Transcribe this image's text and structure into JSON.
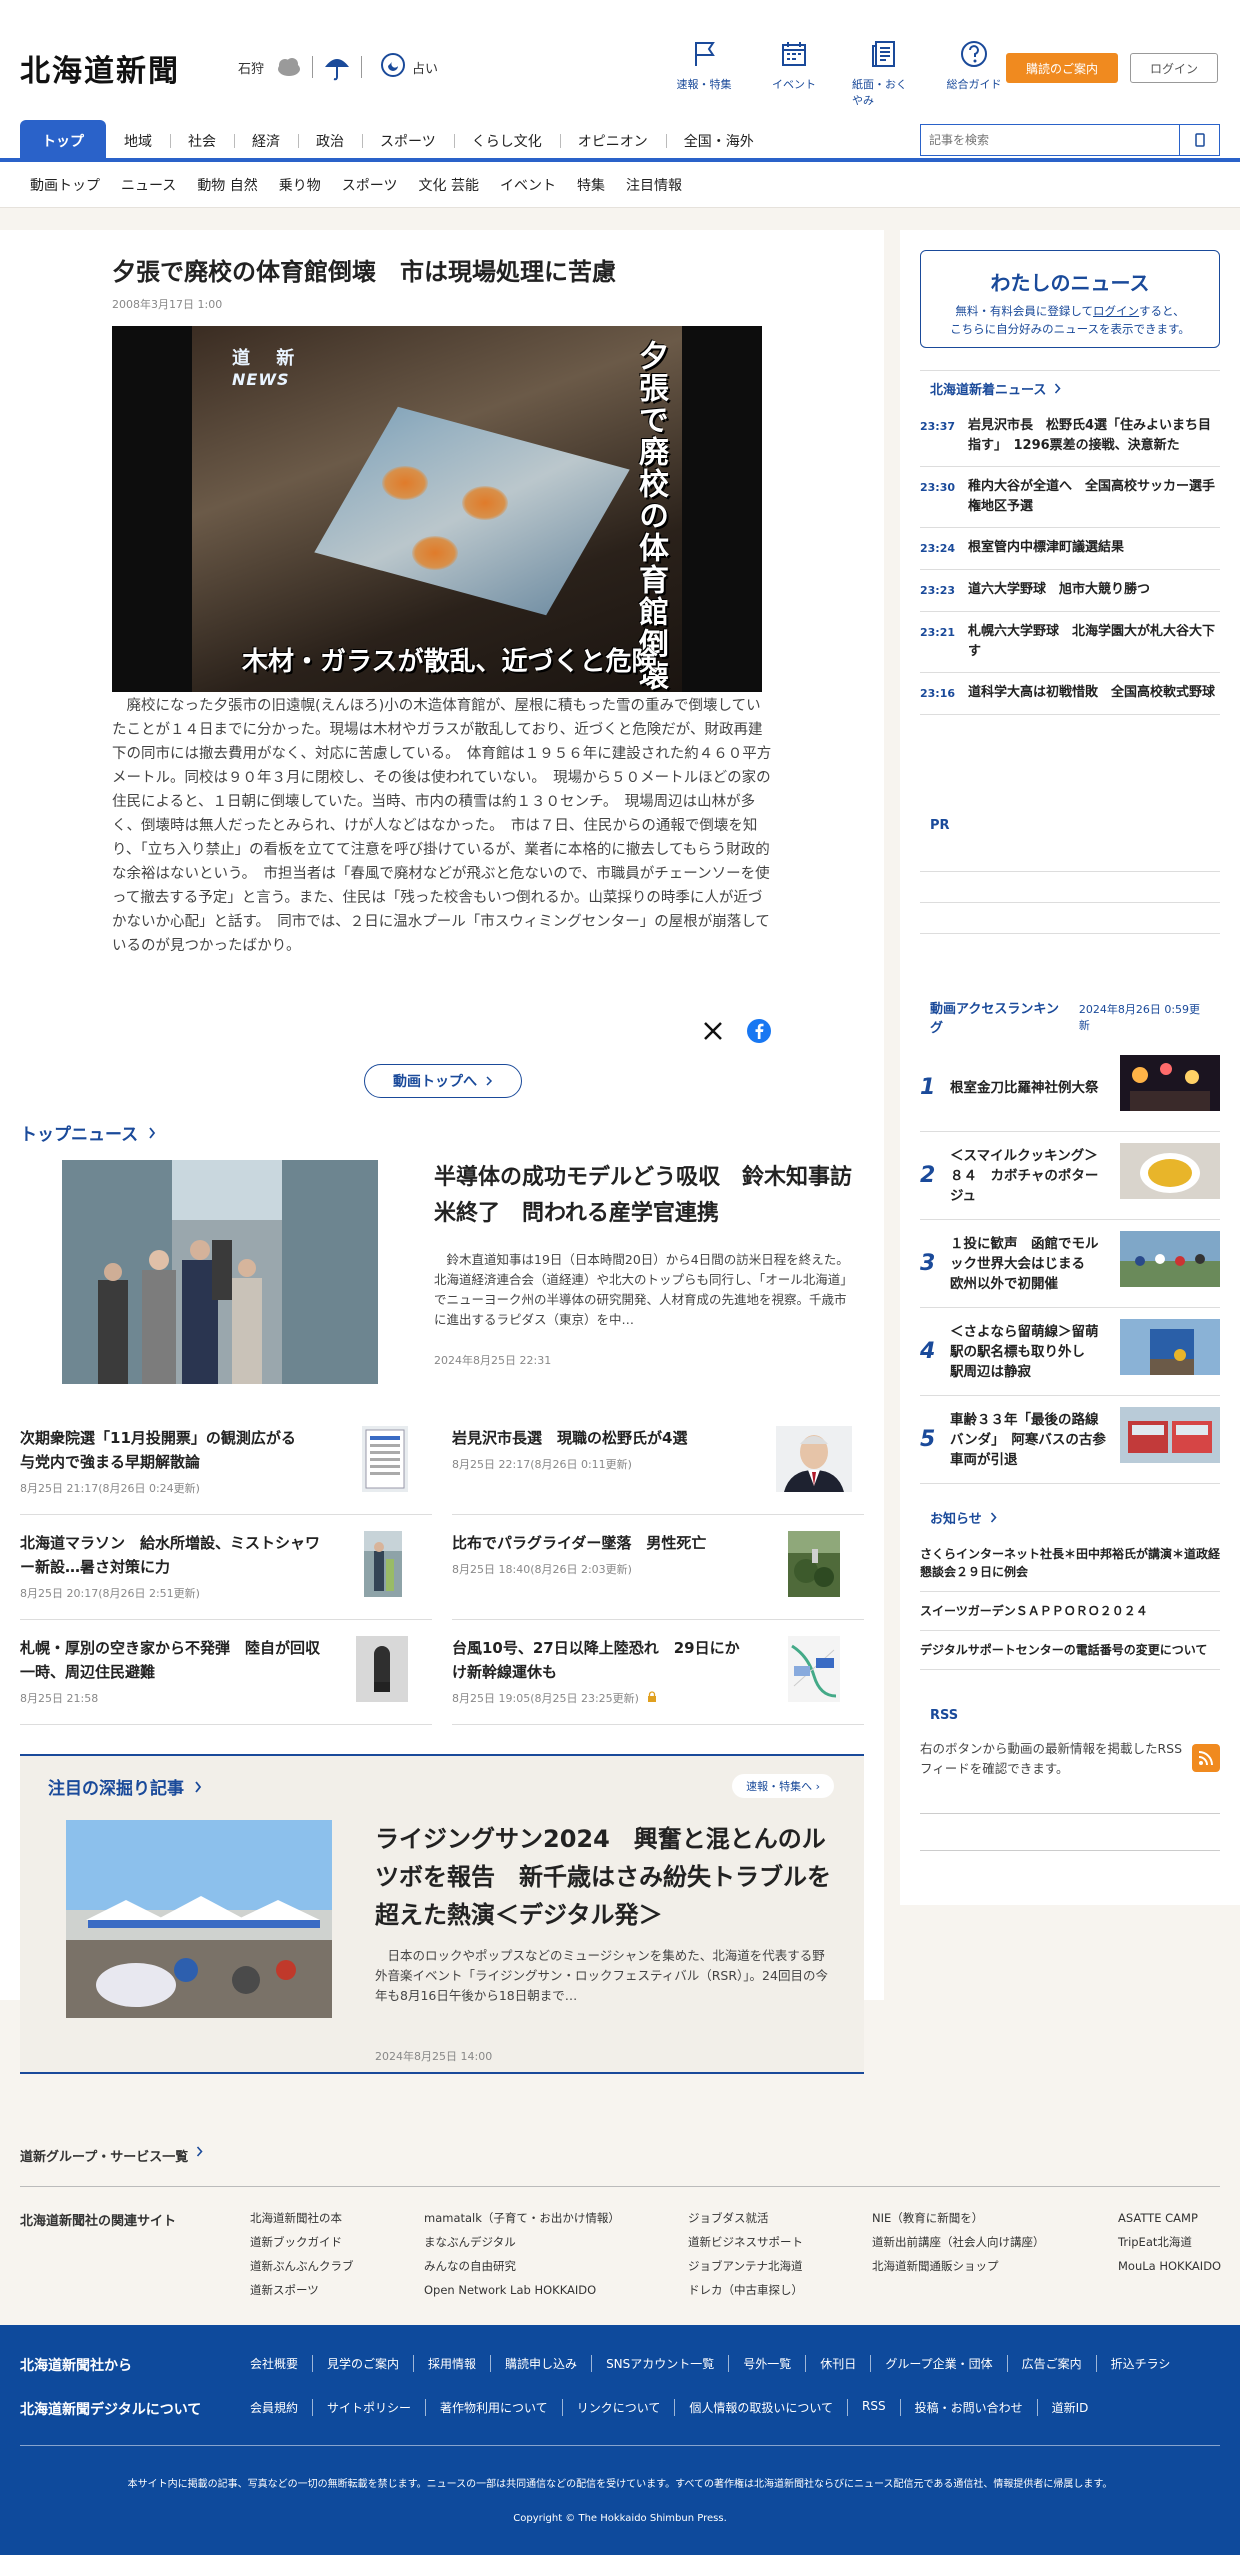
{
  "header": {
    "logo": "北海道新聞",
    "weather_area": "石狩",
    "fortune": "占い",
    "nav": [
      {
        "label": "速報・特集"
      },
      {
        "label": "イベント"
      },
      {
        "label": "紙面・おくやみ"
      },
      {
        "label": "総合ガイド"
      }
    ],
    "subscribe": "購読のご案内",
    "login": "ログイン"
  },
  "mainnav": {
    "tabs": [
      "トップ",
      "地域",
      "社会",
      "経済",
      "政治",
      "スポーツ",
      "くらし文化",
      "オピニオン",
      "全国・海外"
    ],
    "search_placeholder": "記事を検索"
  },
  "subnav": [
    "動画トップ",
    "ニュース",
    "動物 自然",
    "乗り物",
    "スポーツ",
    "文化 芸能",
    "イベント",
    "特集",
    "注目情報"
  ],
  "article": {
    "title": "夕張で廃校の体育館倒壊　市は現場処理に苦慮",
    "date": "2008年3月17日 1:00",
    "photo_vertical_title": "夕張で廃校の体育館倒壊",
    "photo_caption": "木材・ガラスが散乱、近づくと危険",
    "photo_logo_jp": "道 新",
    "photo_logo_en": "NEWS",
    "body": "廃校になった夕張市の旧遠幌(えんほろ)小の木造体育館が、屋根に積もった雪の重みで倒壊していたことが１４日までに分かった。現場は木材やガラスが散乱しており、近づくと危険だが、財政再建下の同市には撤去費用がなく、対応に苦慮している。　体育館は１９５６年に建設された約４６０平方メートル。同校は９０年３月に閉校し、その後は使われていない。　現場から５０メートルほどの家の住民によると、１日朝に倒壊していた。当時、市内の積雪は約１３０センチ。　現場周辺は山林が多く、倒壊時は無人だったとみられ、けが人などはなかった。　市は７日、住民からの通報で倒壊を知り、「立ち入り禁止」の看板を立てて注意を呼び掛けているが、業者に本格的に撤去してもらう財政的な余裕はないという。　市担当者は「春風で廃材などが飛ぶと危ないので、市職員がチェーンソーを使って撤去する予定」と言う。また、住民は「残った校舎もいつ倒れるか。山菜採りの時季に人が近づかないか心配」と話す。　同市では、２日に温水プール「市スウィミングセンター」の屋根が崩落しているのが見つかったばかり。",
    "video_top": "動画トップへ"
  },
  "top_news": {
    "heading": "トップニュース",
    "main": {
      "title": "半導体の成功モデルどう吸収　鈴木知事訪米終了　問われる産学官連携",
      "summary": "鈴木直道知事は19日（日本時間20日）から4日間の訪米日程を終えた。北海道経済連合会（道経連）や北大のトップらも同行し、「オール北海道」でニューヨーク州の半導体の研究開発、人材育成の先進地を視察。千歳市に進出するラピダス（東京）を中…",
      "date": "2024年8月25日 22:31"
    },
    "items": [
      {
        "title": "次期衆院選「11月投開票」の観測広がる　与党内で強まる早期解散論",
        "date": "8月25日 21:17(8月26日 0:24更新)"
      },
      {
        "title": "岩見沢市長選　現職の松野氏が4選",
        "date": "8月25日 22:17(8月26日 0:11更新)"
      },
      {
        "title": "北海道マラソン　給水所増設、ミストシャワー新設…暑さ対策に力",
        "date": "8月25日 20:17(8月26日 2:51更新)"
      },
      {
        "title": "比布でパラグライダー墜落　男性死亡",
        "date": "8月25日 18:40(8月26日 2:03更新)"
      },
      {
        "title": "札幌・厚別の空き家から不発弾　陸自が回収　一時、周辺住民避難",
        "date": "8月25日 21:58"
      },
      {
        "title": "台風10号、27日以降上陸恐れ　29日にかけ新幹線運休も",
        "date": "8月25日 19:05(8月25日 23:25更新)"
      }
    ]
  },
  "deep_dive": {
    "heading": "注目の深掘り記事",
    "link": "速報・特集へ",
    "title": "ライジングサン2024　興奮と混とんのルツボを報告　新千歳はさみ紛失トラブルを超えた熱演＜デジタル発＞",
    "summary": "日本のロックやポップスなどのミュージシャンを集めた、北海道を代表する野外音楽イベント「ライジングサン・ロックフェスティバル（RSR）」。24回目の今年も8月16日午後から18日朝まで…",
    "date": "2024年8月25日 14:00"
  },
  "sidebar": {
    "mynews_title": "わたしのニュース",
    "mynews_text_1": "無料・有料会員に登録して",
    "mynews_login": "ログイン",
    "mynews_text_2": "すると、",
    "mynews_text_3": "こちらに自分好みのニュースを表示できます。",
    "latest_heading": "北海道新着ニュース",
    "latest": [
      {
        "time": "23:37",
        "title": "岩見沢市長　松野氏4選「住みよいまち目指す」　1296票差の接戦、決意新た"
      },
      {
        "time": "23:30",
        "title": "稚内大谷が全道へ　全国高校サッカー選手権地区予選"
      },
      {
        "time": "23:24",
        "title": "根室管内中標津町議選結果"
      },
      {
        "time": "23:23",
        "title": "道六大学野球　旭市大競り勝つ"
      },
      {
        "time": "23:21",
        "title": "札幌六大学野球　北海学園大が札大谷大下す"
      },
      {
        "time": "23:16",
        "title": "道科学大高は初戦惜敗　全国高校軟式野球"
      }
    ],
    "pr_heading": "PR",
    "ranking_heading": "動画アクセスランキング",
    "ranking_date": "2024年8月26日 0:59更新",
    "ranking": [
      {
        "rank": "1",
        "title": "根室金刀比羅神社例大祭"
      },
      {
        "rank": "2",
        "title": "＜スマイルクッキング＞８４　カボチャのポタージュ"
      },
      {
        "rank": "3",
        "title": "１投に歓声　函館でモルック世界大会はじまる　欧州以外で初開催"
      },
      {
        "rank": "4",
        "title": "＜さよなら留萌線＞留萌駅の駅名標も取り外し　駅周辺は静寂"
      },
      {
        "rank": "5",
        "title": "車齢３３年「最後の路線バンダ」　阿寒バスの古参車両が引退"
      }
    ],
    "notice_heading": "お知らせ",
    "notices": [
      "さくらインターネット社長＊田中邦裕氏が講演＊道政経懇談会２９日に例会",
      "スイーツガーデンＳＡＰＰＯＲＯ２０２４",
      "デジタルサポートセンターの電話番号の変更について"
    ],
    "rss_heading": "RSS",
    "rss_text": "右のボタンから動画の最新情報を掲載したRSSフィードを確認できます。"
  },
  "group": {
    "heading": "道新グループ・サービス一覧",
    "label": "北海道新聞社の関連サイト",
    "col1": [
      "北海道新聞社の本",
      "道新ブックガイド",
      "道新ぶんぶんクラブ",
      "道新スポーツ"
    ],
    "col2": [
      "mamatalk（子育て・お出かけ情報）",
      "まなぶんデジタル",
      "みんなの自由研究",
      "Open Network Lab HOKKAIDO"
    ],
    "col3": [
      "ジョブダス就活",
      "道新ビジネスサポート",
      "ジョブアンテナ北海道",
      "ドレカ（中古車探し）"
    ],
    "col4": [
      "NIE（教育に新聞を）",
      "道新出前講座（社会人向け講座）",
      "北海道新聞通販ショップ"
    ],
    "col5": [
      "ASATTE CAMP",
      "TripEat北海道",
      "MouLa HOKKAIDO"
    ]
  },
  "footer": {
    "label1": "北海道新聞社から",
    "links1": [
      "会社概要",
      "見学のご案内",
      "採用情報",
      "購読申し込み",
      "SNSアカウント一覧",
      "号外一覧",
      "休刊日",
      "グループ企業・団体",
      "広告ご案内",
      "折込チラシ"
    ],
    "label2": "北海道新聞デジタルについて",
    "links2": [
      "会員規約",
      "サイトポリシー",
      "著作物利用について",
      "リンクについて",
      "個人情報の取扱いについて",
      "RSS",
      "投稿・お問い合わせ",
      "道新ID"
    ],
    "notice": "本サイト内に掲載の記事、写真などの一切の無断転載を禁じます。ニュースの一部は共同通信などの配信を受けています。すべての著作権は北海道新聞社ならびにニュース配信元である通信社、情報提供者に帰属します。",
    "copyright": "Copyright © The Hokkaido Shimbun Press."
  }
}
